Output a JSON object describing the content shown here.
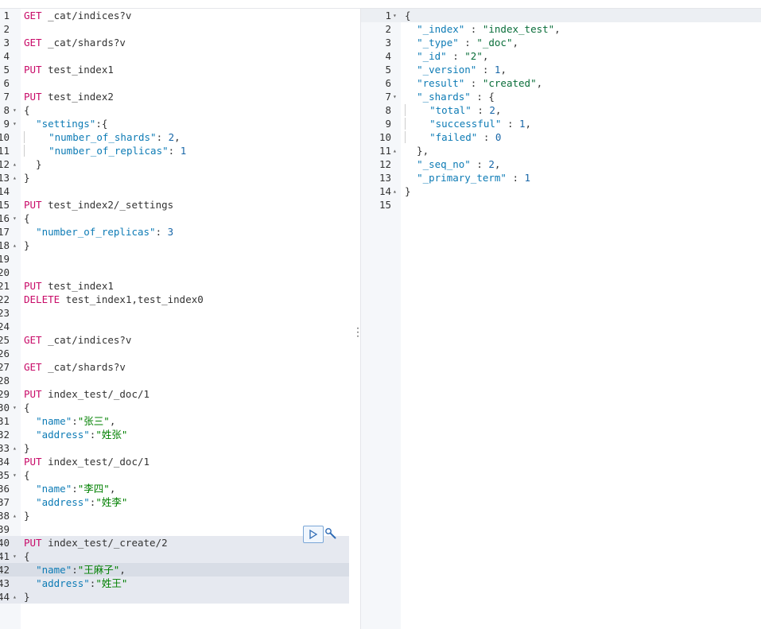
{
  "request_editor": {
    "lines": [
      {
        "num": "1",
        "fold": "",
        "tokens": [
          {
            "t": "GET",
            "c": "m"
          },
          {
            "t": " _cat/indices?v",
            "c": ""
          }
        ]
      },
      {
        "num": "2",
        "fold": "",
        "tokens": []
      },
      {
        "num": "3",
        "fold": "",
        "tokens": [
          {
            "t": "GET",
            "c": "m"
          },
          {
            "t": " _cat/shards?v",
            "c": ""
          }
        ]
      },
      {
        "num": "4",
        "fold": "",
        "tokens": []
      },
      {
        "num": "5",
        "fold": "",
        "tokens": [
          {
            "t": "PUT",
            "c": "m"
          },
          {
            "t": " test_index1",
            "c": ""
          }
        ]
      },
      {
        "num": "6",
        "fold": "",
        "tokens": []
      },
      {
        "num": "7",
        "fold": "",
        "tokens": [
          {
            "t": "PUT",
            "c": "m"
          },
          {
            "t": " test_index2",
            "c": ""
          }
        ]
      },
      {
        "num": "8",
        "fold": "▾",
        "tokens": [
          {
            "t": "{",
            "c": ""
          }
        ]
      },
      {
        "num": "9",
        "fold": "▾",
        "tokens": [
          {
            "t": "  ",
            "c": ""
          },
          {
            "t": "\"settings\"",
            "c": "k"
          },
          {
            "t": ":{",
            "c": ""
          }
        ]
      },
      {
        "num": "10",
        "fold": "",
        "tokens": [
          {
            "t": "    ",
            "c": "bar"
          },
          {
            "t": "\"number_of_shards\"",
            "c": "k"
          },
          {
            "t": ": ",
            "c": ""
          },
          {
            "t": "2",
            "c": "n"
          },
          {
            "t": ",",
            "c": ""
          }
        ]
      },
      {
        "num": "11",
        "fold": "",
        "tokens": [
          {
            "t": "    ",
            "c": "bar"
          },
          {
            "t": "\"number_of_replicas\"",
            "c": "k"
          },
          {
            "t": ": ",
            "c": ""
          },
          {
            "t": "1",
            "c": "n"
          }
        ]
      },
      {
        "num": "12",
        "fold": "▴",
        "tokens": [
          {
            "t": "  }",
            "c": ""
          }
        ]
      },
      {
        "num": "13",
        "fold": "▴",
        "tokens": [
          {
            "t": "}",
            "c": ""
          }
        ]
      },
      {
        "num": "14",
        "fold": "",
        "tokens": []
      },
      {
        "num": "15",
        "fold": "",
        "tokens": [
          {
            "t": "PUT",
            "c": "m"
          },
          {
            "t": " test_index2/_settings",
            "c": ""
          }
        ]
      },
      {
        "num": "16",
        "fold": "▾",
        "tokens": [
          {
            "t": "{",
            "c": ""
          }
        ]
      },
      {
        "num": "17",
        "fold": "",
        "tokens": [
          {
            "t": "  ",
            "c": ""
          },
          {
            "t": "\"number_of_replicas\"",
            "c": "k"
          },
          {
            "t": ": ",
            "c": ""
          },
          {
            "t": "3",
            "c": "n"
          }
        ]
      },
      {
        "num": "18",
        "fold": "▴",
        "tokens": [
          {
            "t": "}",
            "c": ""
          }
        ]
      },
      {
        "num": "19",
        "fold": "",
        "tokens": []
      },
      {
        "num": "20",
        "fold": "",
        "tokens": []
      },
      {
        "num": "21",
        "fold": "",
        "tokens": [
          {
            "t": "PUT",
            "c": "m"
          },
          {
            "t": " test_index1",
            "c": ""
          }
        ]
      },
      {
        "num": "22",
        "fold": "",
        "tokens": [
          {
            "t": "DELETE",
            "c": "m"
          },
          {
            "t": " test_index1,test_index0",
            "c": ""
          }
        ]
      },
      {
        "num": "23",
        "fold": "",
        "tokens": []
      },
      {
        "num": "24",
        "fold": "",
        "tokens": []
      },
      {
        "num": "25",
        "fold": "",
        "tokens": [
          {
            "t": "GET",
            "c": "m"
          },
          {
            "t": " _cat/indices?v",
            "c": ""
          }
        ]
      },
      {
        "num": "26",
        "fold": "",
        "tokens": []
      },
      {
        "num": "27",
        "fold": "",
        "tokens": [
          {
            "t": "GET",
            "c": "m"
          },
          {
            "t": " _cat/shards?v",
            "c": ""
          }
        ]
      },
      {
        "num": "28",
        "fold": "",
        "tokens": []
      },
      {
        "num": "29",
        "fold": "",
        "tokens": [
          {
            "t": "PUT",
            "c": "m"
          },
          {
            "t": " index_test/_doc/1",
            "c": ""
          }
        ]
      },
      {
        "num": "30",
        "fold": "▾",
        "tokens": [
          {
            "t": "{",
            "c": ""
          }
        ]
      },
      {
        "num": "31",
        "fold": "",
        "tokens": [
          {
            "t": "  ",
            "c": ""
          },
          {
            "t": "\"name\"",
            "c": "k"
          },
          {
            "t": ":",
            "c": ""
          },
          {
            "t": "\"张三\"",
            "c": "s"
          },
          {
            "t": ",",
            "c": ""
          }
        ]
      },
      {
        "num": "32",
        "fold": "",
        "tokens": [
          {
            "t": "  ",
            "c": ""
          },
          {
            "t": "\"address\"",
            "c": "k"
          },
          {
            "t": ":",
            "c": ""
          },
          {
            "t": "\"姓张\"",
            "c": "s"
          }
        ]
      },
      {
        "num": "33",
        "fold": "▴",
        "tokens": [
          {
            "t": "}",
            "c": ""
          }
        ]
      },
      {
        "num": "34",
        "fold": "",
        "tokens": [
          {
            "t": "PUT",
            "c": "m"
          },
          {
            "t": " index_test/_doc/1",
            "c": ""
          }
        ]
      },
      {
        "num": "35",
        "fold": "▾",
        "tokens": [
          {
            "t": "{",
            "c": ""
          }
        ]
      },
      {
        "num": "36",
        "fold": "",
        "tokens": [
          {
            "t": "  ",
            "c": ""
          },
          {
            "t": "\"name\"",
            "c": "k"
          },
          {
            "t": ":",
            "c": ""
          },
          {
            "t": "\"李四\"",
            "c": "s"
          },
          {
            "t": ",",
            "c": ""
          }
        ]
      },
      {
        "num": "37",
        "fold": "",
        "tokens": [
          {
            "t": "  ",
            "c": ""
          },
          {
            "t": "\"address\"",
            "c": "k"
          },
          {
            "t": ":",
            "c": ""
          },
          {
            "t": "\"姓李\"",
            "c": "s"
          }
        ]
      },
      {
        "num": "38",
        "fold": "▴",
        "tokens": [
          {
            "t": "}",
            "c": ""
          }
        ]
      },
      {
        "num": "39",
        "fold": "",
        "tokens": []
      },
      {
        "num": "40",
        "fold": "",
        "sel": true,
        "tokens": [
          {
            "t": "PUT",
            "c": "m"
          },
          {
            "t": " index_test/_create/2",
            "c": ""
          }
        ]
      },
      {
        "num": "41",
        "fold": "▾",
        "sel": true,
        "tokens": [
          {
            "t": "{",
            "c": ""
          }
        ]
      },
      {
        "num": "42",
        "fold": "",
        "cur": true,
        "tokens": [
          {
            "t": "  ",
            "c": ""
          },
          {
            "t": "\"name\"",
            "c": "k"
          },
          {
            "t": ":",
            "c": ""
          },
          {
            "t": "\"王麻子\"",
            "c": "s"
          },
          {
            "t": ",",
            "c": ""
          }
        ]
      },
      {
        "num": "43",
        "fold": "",
        "sel": true,
        "tokens": [
          {
            "t": "  ",
            "c": ""
          },
          {
            "t": "\"address\"",
            "c": "k"
          },
          {
            "t": ":",
            "c": ""
          },
          {
            "t": "\"姓王\"",
            "c": "s"
          }
        ]
      },
      {
        "num": "44",
        "fold": "▴",
        "sel": true,
        "tokens": [
          {
            "t": "}",
            "c": ""
          }
        ]
      }
    ],
    "actions": {
      "run_icon": "play-icon",
      "settings_icon": "wrench-icon"
    }
  },
  "divider": {
    "handle_glyph": "⋮"
  },
  "response_viewer": {
    "lines": [
      {
        "num": "1",
        "fold": "▾",
        "tokens": [
          {
            "t": "{",
            "c": ""
          }
        ]
      },
      {
        "num": "2",
        "fold": "",
        "tokens": [
          {
            "t": "  ",
            "c": ""
          },
          {
            "t": "\"_index\"",
            "c": "rk"
          },
          {
            "t": " : ",
            "c": ""
          },
          {
            "t": "\"index_test\"",
            "c": "rs"
          },
          {
            "t": ",",
            "c": ""
          }
        ]
      },
      {
        "num": "3",
        "fold": "",
        "tokens": [
          {
            "t": "  ",
            "c": ""
          },
          {
            "t": "\"_type\"",
            "c": "rk"
          },
          {
            "t": " : ",
            "c": ""
          },
          {
            "t": "\"_doc\"",
            "c": "rs"
          },
          {
            "t": ",",
            "c": ""
          }
        ]
      },
      {
        "num": "4",
        "fold": "",
        "tokens": [
          {
            "t": "  ",
            "c": ""
          },
          {
            "t": "\"_id\"",
            "c": "rk"
          },
          {
            "t": " : ",
            "c": ""
          },
          {
            "t": "\"2\"",
            "c": "rs"
          },
          {
            "t": ",",
            "c": ""
          }
        ]
      },
      {
        "num": "5",
        "fold": "",
        "tokens": [
          {
            "t": "  ",
            "c": ""
          },
          {
            "t": "\"_version\"",
            "c": "rk"
          },
          {
            "t": " : ",
            "c": ""
          },
          {
            "t": "1",
            "c": "rn"
          },
          {
            "t": ",",
            "c": ""
          }
        ]
      },
      {
        "num": "6",
        "fold": "",
        "tokens": [
          {
            "t": "  ",
            "c": ""
          },
          {
            "t": "\"result\"",
            "c": "rk"
          },
          {
            "t": " : ",
            "c": ""
          },
          {
            "t": "\"created\"",
            "c": "rs"
          },
          {
            "t": ",",
            "c": ""
          }
        ]
      },
      {
        "num": "7",
        "fold": "▾",
        "tokens": [
          {
            "t": "  ",
            "c": ""
          },
          {
            "t": "\"_shards\"",
            "c": "rk"
          },
          {
            "t": " : {",
            "c": ""
          }
        ]
      },
      {
        "num": "8",
        "fold": "",
        "tokens": [
          {
            "t": "    ",
            "c": "bar"
          },
          {
            "t": "\"total\"",
            "c": "rk"
          },
          {
            "t": " : ",
            "c": ""
          },
          {
            "t": "2",
            "c": "rn"
          },
          {
            "t": ",",
            "c": ""
          }
        ]
      },
      {
        "num": "9",
        "fold": "",
        "tokens": [
          {
            "t": "    ",
            "c": "bar"
          },
          {
            "t": "\"successful\"",
            "c": "rk"
          },
          {
            "t": " : ",
            "c": ""
          },
          {
            "t": "1",
            "c": "rn"
          },
          {
            "t": ",",
            "c": ""
          }
        ]
      },
      {
        "num": "10",
        "fold": "",
        "tokens": [
          {
            "t": "    ",
            "c": "bar"
          },
          {
            "t": "\"failed\"",
            "c": "rk"
          },
          {
            "t": " : ",
            "c": ""
          },
          {
            "t": "0",
            "c": "rn"
          }
        ]
      },
      {
        "num": "11",
        "fold": "▴",
        "tokens": [
          {
            "t": "  },",
            "c": ""
          }
        ]
      },
      {
        "num": "12",
        "fold": "",
        "tokens": [
          {
            "t": "  ",
            "c": ""
          },
          {
            "t": "\"_seq_no\"",
            "c": "rk"
          },
          {
            "t": " : ",
            "c": ""
          },
          {
            "t": "2",
            "c": "rn"
          },
          {
            "t": ",",
            "c": ""
          }
        ]
      },
      {
        "num": "13",
        "fold": "",
        "tokens": [
          {
            "t": "  ",
            "c": ""
          },
          {
            "t": "\"_primary_term\"",
            "c": "rk"
          },
          {
            "t": " : ",
            "c": ""
          },
          {
            "t": "1",
            "c": "rn"
          }
        ]
      },
      {
        "num": "14",
        "fold": "▴",
        "tokens": [
          {
            "t": "}",
            "c": ""
          }
        ]
      },
      {
        "num": "15",
        "fold": "",
        "tokens": []
      }
    ]
  },
  "colors": {
    "method": "#c80a68",
    "key": "#0d7bb5",
    "number": "#1967a8",
    "string": "#008000",
    "selection": "#e6e9f0"
  }
}
